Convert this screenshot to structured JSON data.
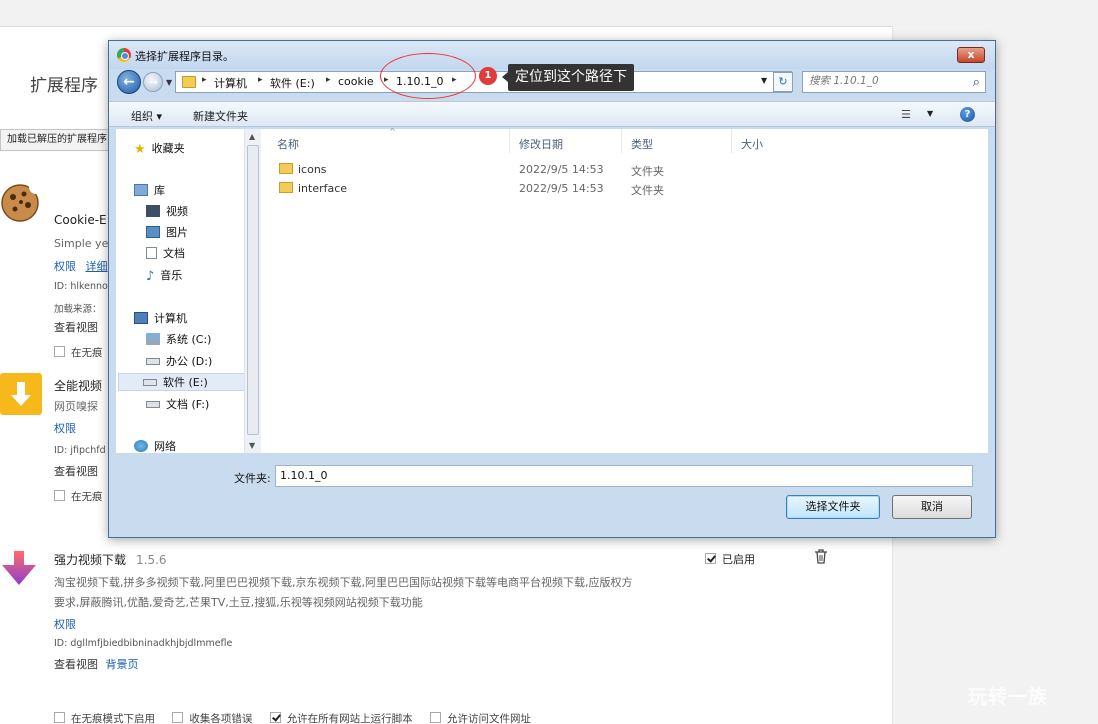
{
  "ext_page": {
    "title": "扩展程序",
    "load_button": "加载已解压的扩展程序",
    "extensions": [
      {
        "name": "Cookie-E",
        "desc": "Simple ye",
        "link_perms": "权限",
        "link_details": "详细",
        "id": "ID: hlkenno",
        "source": "加载来源：",
        "views": "查看视图",
        "incognito": "在无痕"
      },
      {
        "name": "全能视频",
        "desc": "网页嗅探",
        "link_perms": "权限",
        "id": "ID: jfipchfd",
        "views": "查看视图",
        "incognito": "在无痕"
      },
      {
        "name": "强力视频下载",
        "version": "1.5.6",
        "enabled_label": "已启用",
        "desc_line1": "淘宝视频下载,拼多多视频下载,阿里巴巴视频下载,京东视频下载,阿里巴巴国际站视频下载等电商平台视频下载,应版权方",
        "desc_line2": "要求,屏蔽腾讯,优酷,爱奇艺,芒果TV,土豆,搜狐,乐视等视频网站视频下载功能",
        "link_perms": "权限",
        "id": "ID: dgllmfjbiedbibninadkhjbjdlmmefle",
        "views": "查看视图",
        "views_link": "背景页",
        "options": [
          "在无痕模式下启用",
          "收集各项错误",
          "允许在所有网站上运行脚本",
          "允许访问文件网址"
        ]
      }
    ]
  },
  "dialog": {
    "title": "选择扩展程序目录。",
    "close": "x",
    "breadcrumbs": [
      "计算机",
      "软件 (E:)",
      "cookie",
      "1.10.1_0"
    ],
    "search_placeholder": "搜索 1.10.1_0",
    "toolbar": {
      "organize": "组织 ▾",
      "new_folder": "新建文件夹"
    },
    "nav": {
      "favorites": "收藏夹",
      "library": "库",
      "video": "视频",
      "pictures": "图片",
      "docs": "文档",
      "music": "音乐",
      "computer": "计算机",
      "drive_c": "系统 (C:)",
      "drive_d": "办公 (D:)",
      "drive_e": "软件 (E:)",
      "drive_f": "文档 (F:)",
      "network": "网络"
    },
    "columns": {
      "name": "名称",
      "date": "修改日期",
      "type": "类型",
      "size": "大小"
    },
    "files": [
      {
        "name": "icons",
        "date": "2022/9/5 14:53",
        "type": "文件夹"
      },
      {
        "name": "interface",
        "date": "2022/9/5 14:53",
        "type": "文件夹"
      }
    ],
    "folder_label": "文件夹:",
    "folder_value": "1.10.1_0",
    "select_button": "选择文件夹",
    "cancel_button": "取消"
  },
  "annotation": {
    "badge": "1",
    "tip": "定位到这个路径下"
  },
  "watermark": "玩转一族",
  "colors": {
    "accent": "#e23a3a",
    "link": "#1a5fb4"
  }
}
